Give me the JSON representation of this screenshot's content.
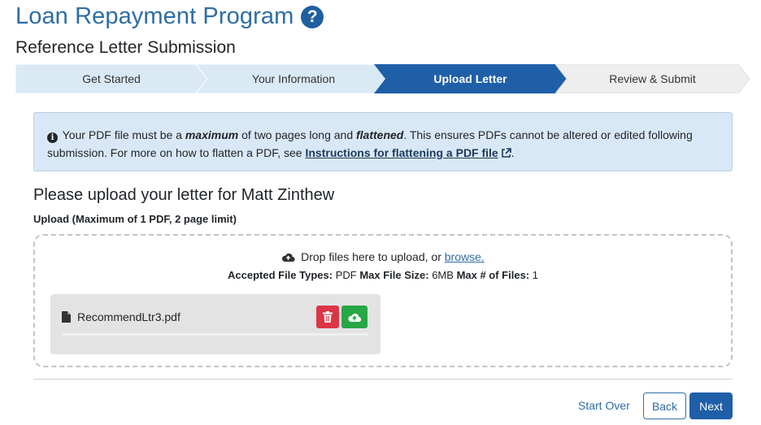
{
  "header": {
    "title": "Loan Repayment Program",
    "help_icon": "question-circle-icon",
    "subtitle": "Reference Letter Submission"
  },
  "steps": [
    {
      "label": "Get Started",
      "state": "complete"
    },
    {
      "label": "Your Information",
      "state": "complete"
    },
    {
      "label": "Upload Letter",
      "state": "active"
    },
    {
      "label": "Review & Submit",
      "state": "pending"
    }
  ],
  "alert": {
    "icon": "info-circle-icon",
    "text_1": "Your PDF file must be a ",
    "emph_1": "maximum",
    "text_2": " of two pages long and ",
    "emph_2": "flattened",
    "text_3": ". This ensures PDFs cannot be altered or edited following submission. For more on how to flatten a PDF, see ",
    "link": "Instructions for flattening a PDF file",
    "text_4": "."
  },
  "upload": {
    "heading": "Please upload your letter for Matt Zinthew",
    "label": "Upload (Maximum of 1 PDF, 2 page limit)",
    "drop_text": "Drop files here to upload, or ",
    "browse_link": "browse.",
    "accepted_types_label": "Accepted File Types:",
    "accepted_types_value": "PDF",
    "max_size_label": "Max File Size:",
    "max_size_value": "6MB",
    "max_files_label": "Max # of Files:",
    "max_files_value": "1"
  },
  "file": {
    "name": "RecommendLtr3.pdf",
    "progress": 0
  },
  "footer": {
    "start_over": "Start Over",
    "back": "Back",
    "next": "Next"
  },
  "colors": {
    "brand_blue": "#2e6da4",
    "step_complete": "#d9eaf5",
    "step_active": "#1f5fa8",
    "step_pending": "#eeeeee",
    "alert_bg": "#d9e8f6",
    "delete_red": "#dc3545",
    "upload_green": "#28a745"
  }
}
